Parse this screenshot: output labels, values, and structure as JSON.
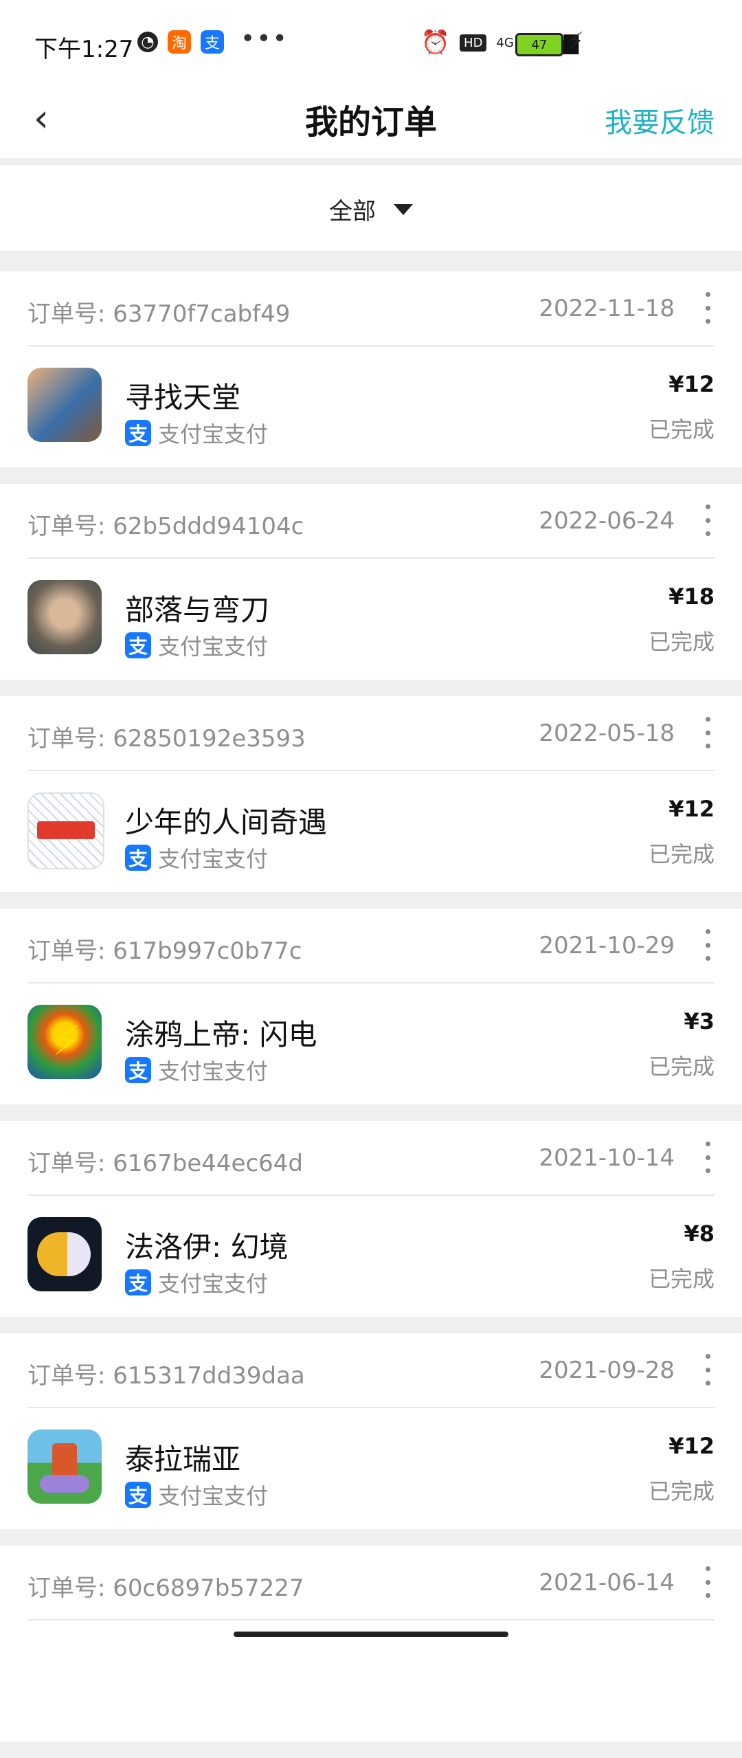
{
  "status_bar": {
    "time": "下午1:27",
    "battery": "47",
    "network": "4G",
    "hd": "HD"
  },
  "header": {
    "title": "我的订单",
    "feedback": "我要反馈"
  },
  "filter": {
    "label": "全部"
  },
  "orders": [
    {
      "order_no": "订单号: 63770f7cabf49",
      "date": "2022-11-18",
      "app_name": "寻找天堂",
      "pay_method": "支付宝支付",
      "price": "¥12",
      "status": "已完成"
    },
    {
      "order_no": "订单号: 62b5ddd94104c",
      "date": "2022-06-24",
      "app_name": "部落与弯刀",
      "pay_method": "支付宝支付",
      "price": "¥18",
      "status": "已完成"
    },
    {
      "order_no": "订单号: 62850192e3593",
      "date": "2022-05-18",
      "app_name": "少年的人间奇遇",
      "pay_method": "支付宝支付",
      "price": "¥12",
      "status": "已完成"
    },
    {
      "order_no": "订单号: 617b997c0b77c",
      "date": "2021-10-29",
      "app_name": "涂鸦上帝: 闪电",
      "pay_method": "支付宝支付",
      "price": "¥3",
      "status": "已完成"
    },
    {
      "order_no": "订单号: 6167be44ec64d",
      "date": "2021-10-14",
      "app_name": "法洛伊: 幻境",
      "pay_method": "支付宝支付",
      "price": "¥8",
      "status": "已完成"
    },
    {
      "order_no": "订单号: 615317dd39daa",
      "date": "2021-09-28",
      "app_name": "泰拉瑞亚",
      "pay_method": "支付宝支付",
      "price": "¥12",
      "status": "已完成"
    },
    {
      "order_no": "订单号: 60c6897b57227",
      "date": "2021-06-14"
    }
  ],
  "colors": {
    "accent": "#1bb3c5",
    "alipay": "#1677ff",
    "muted_text": "#8e8e8e",
    "background": "#efefef"
  }
}
